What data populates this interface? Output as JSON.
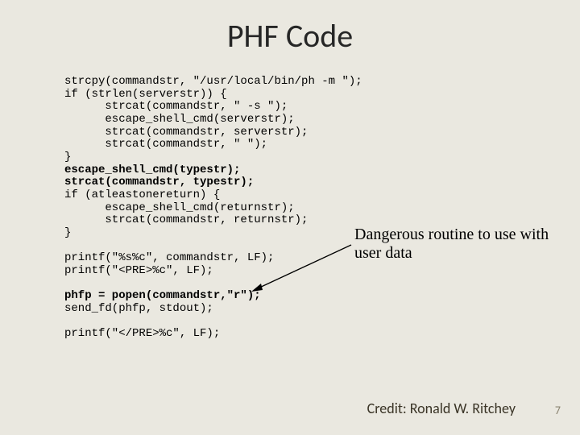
{
  "title": "PHF Code",
  "code": {
    "l1": "strcpy(commandstr, \"/usr/local/bin/ph -m \");",
    "l2": "if (strlen(serverstr)) {",
    "l3": "      strcat(commandstr, \" -s \");",
    "l4": "      escape_shell_cmd(serverstr);",
    "l5": "      strcat(commandstr, serverstr);",
    "l6": "      strcat(commandstr, \" \");",
    "l7": "}",
    "l8": "escape_shell_cmd(typestr);",
    "l9": "strcat(commandstr, typestr);",
    "l10": "if (atleastonereturn) {",
    "l11": "      escape_shell_cmd(returnstr);",
    "l12": "      strcat(commandstr, returnstr);",
    "l13": "}",
    "l14": "",
    "l15": "printf(\"%s%c\", commandstr, LF);",
    "l16": "printf(\"<PRE>%c\", LF);",
    "l17": "",
    "l18": "phfp = popen(commandstr,\"r\");",
    "l19": "send_fd(phfp, stdout);",
    "l20": "",
    "l21": "printf(\"</PRE>%c\", LF);"
  },
  "annotation": "Dangerous routine to use with user data",
  "credit": "Credit: Ronald W. Ritchey",
  "page_number": "7"
}
